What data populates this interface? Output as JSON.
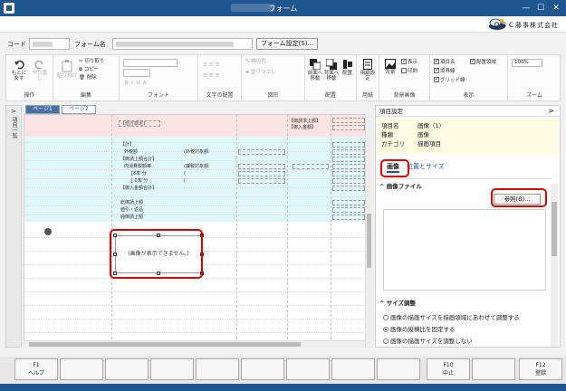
{
  "window": {
    "title": "フォーム",
    "company": "ＯＢＣ藤事株式会社"
  },
  "form": {
    "code_label": "コード",
    "name_label": "フォーム名",
    "settings_button": "フォーム設定(S)..."
  },
  "ribbon": {
    "undo": "もとに戻す",
    "redo": "やり直し",
    "paste": "貼り付け",
    "cut": "切り取り",
    "copy": "コピー",
    "delete": "削除",
    "line_color": "線の色",
    "fill": "塗りつぶし",
    "bring_front": "前面へ移動",
    "send_back": "背面へ移動",
    "arrange": "配置",
    "paper_setting": "用紙設定",
    "background_image": "背景",
    "show": "表示",
    "print": "印刷",
    "item_name": "項目名",
    "ruled_line": "境界線",
    "grid_line": "グリッド線",
    "layout_area": "配置領域",
    "zoom": "100%",
    "groups": {
      "operation": "操作",
      "edit": "編集",
      "font": "フォント",
      "text_layout": "文字の配置",
      "shape": "図形",
      "layout": "配置",
      "paper": "用紙",
      "background": "背景画像",
      "display": "表示",
      "zoom": "ズーム"
    }
  },
  "sidebar": {
    "label": "項目一覧"
  },
  "tabs": [
    {
      "label": "ページ1"
    },
    {
      "label": "ページ2"
    }
  ],
  "canvas": {
    "header_left": "【借方勘定】",
    "header_r1": "【御請求上額】",
    "header_r2": "【御入金額】",
    "rows": [
      "【計】",
      "外税額",
      "【御請上額合計】",
      "内消費税額等",
      "[8率  分",
      "[ 0率  分",
      "【御入金額合計】",
      "総御請上額",
      "値引・返品",
      "純御請上額"
    ],
    "mid": [
      "(外税対象額:",
      "(課税対象額:",
      "(",
      ")"
    ],
    "image_placeholder": "(画像が表示できません。)"
  },
  "properties": {
    "title": "項目設定",
    "item_name_label": "項目名",
    "item_name_value": "画像（1）",
    "type_label": "種類",
    "type_value": "画像",
    "category_label": "カテゴリ",
    "category_value": "描画項目",
    "tab_image": "画像",
    "tab_position": "位置とサイズ",
    "image_file": "画像ファイル",
    "browse_button": "参照(B)...",
    "size_adjust": "サイズ調整",
    "options": [
      "画像の描画サイズを描画領域にあわせて調整する",
      "画像の縦横比を固定する",
      "画像の描画サイズを調整しない"
    ]
  },
  "fkeys": [
    {
      "key": "F1",
      "label": "ヘルプ"
    },
    {
      "key": "",
      "label": ""
    },
    {
      "key": "",
      "label": ""
    },
    {
      "key": "",
      "label": ""
    },
    {
      "key": "",
      "label": ""
    },
    {
      "key": "",
      "label": ""
    },
    {
      "key": "",
      "label": ""
    },
    {
      "key": "",
      "label": ""
    },
    {
      "key": "",
      "label": ""
    },
    {
      "key": "F10",
      "label": "中止"
    },
    {
      "key": "",
      "label": ""
    },
    {
      "key": "F12",
      "label": "登録"
    }
  ],
  "colors": {
    "titlebar": "#1f5690",
    "header_band": "#fbe3e4",
    "detail_band": "#e0f7f9",
    "highlight": "#e10000"
  }
}
